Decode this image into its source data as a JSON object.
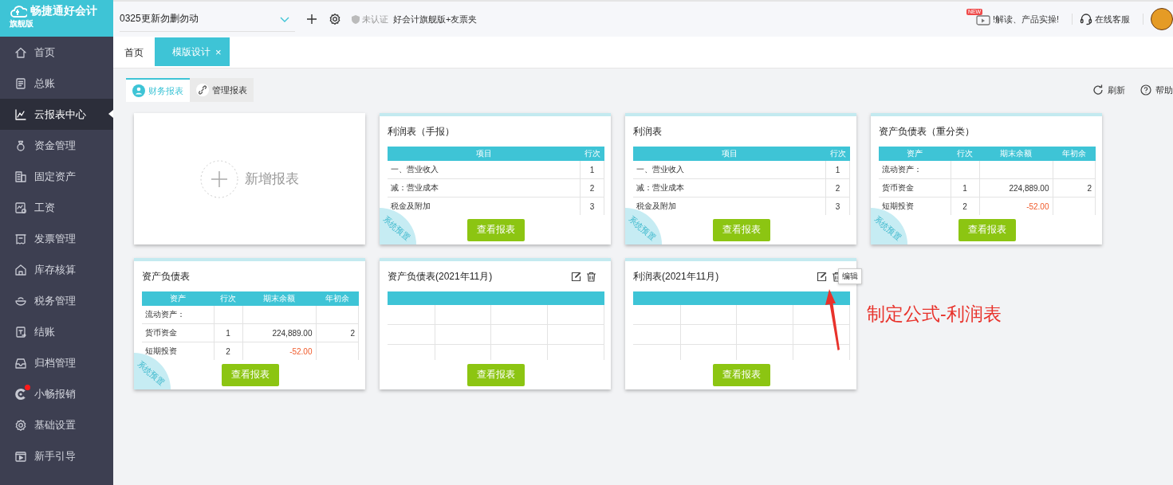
{
  "sidebar": {
    "logo": {
      "name": "畅捷通好会计",
      "edition": "旗舰版"
    },
    "items": [
      {
        "label": "首页",
        "selected": false,
        "notification": false
      },
      {
        "label": "总账",
        "selected": false,
        "notification": false
      },
      {
        "label": "云报表中心",
        "selected": true,
        "notification": false
      },
      {
        "label": "资金管理",
        "selected": false,
        "notification": false
      },
      {
        "label": "固定资产",
        "selected": false,
        "notification": false
      },
      {
        "label": "工资",
        "selected": false,
        "notification": false
      },
      {
        "label": "发票管理",
        "selected": false,
        "notification": false
      },
      {
        "label": "库存核算",
        "selected": false,
        "notification": false
      },
      {
        "label": "税务管理",
        "selected": false,
        "notification": false
      },
      {
        "label": "结账",
        "selected": false,
        "notification": false
      },
      {
        "label": "归档管理",
        "selected": false,
        "notification": false
      },
      {
        "label": "小畅报销",
        "selected": false,
        "notification": true
      },
      {
        "label": "基础设置",
        "selected": false,
        "notification": false
      },
      {
        "label": "新手引导",
        "selected": false,
        "notification": false
      }
    ]
  },
  "topbar": {
    "company": "0325更新勿删勿动",
    "certification": "未认证",
    "edition": "好会计旗舰版+友票夹",
    "promo_badge": "NEW",
    "promo": "!解读、产品实操!",
    "support": "在线客服"
  },
  "tabs": [
    {
      "label": "首页",
      "selected": false
    },
    {
      "label": "模版设计",
      "selected": true,
      "close": "×"
    }
  ],
  "subtabs": [
    {
      "label": "财务报表",
      "selected": true
    },
    {
      "label": "管理报表",
      "selected": false
    }
  ],
  "actions": [
    {
      "label": "刷新"
    },
    {
      "label": "帮助"
    }
  ],
  "cards": [
    {
      "kind": "new",
      "label": "新增报表"
    },
    {
      "kind": "report",
      "title": "利润表（手报）",
      "preset": true,
      "preset_label": "系统预置",
      "editable": false,
      "button": "查看报表",
      "preview": {
        "kind": "table",
        "columns": [
          "项目",
          "行次"
        ],
        "rows": [
          [
            "一、营业收入",
            "1"
          ],
          [
            "减：营业成本",
            "2"
          ],
          [
            "税金及附加",
            "3"
          ]
        ]
      }
    },
    {
      "kind": "report",
      "title": "利润表",
      "preset": true,
      "preset_label": "系统预置",
      "editable": false,
      "button": "查看报表",
      "preview": {
        "kind": "table",
        "columns": [
          "项目",
          "行次"
        ],
        "rows": [
          [
            "一、营业收入",
            "1"
          ],
          [
            "减：营业成本",
            "2"
          ],
          [
            "税金及附加",
            "3"
          ]
        ]
      }
    },
    {
      "kind": "report",
      "title": "资产负债表（重分类）",
      "preset": true,
      "preset_label": "系统预置",
      "editable": false,
      "button": "查看报表",
      "preview": {
        "kind": "table",
        "columns": [
          "资产",
          "行次",
          "期末余额",
          "年初余"
        ],
        "rows": [
          [
            "流动资产：",
            "",
            "",
            ""
          ],
          [
            "货币资金",
            "1",
            "224,889.00",
            "2"
          ],
          [
            "短期投资",
            "2",
            {
              "text": "-52.00",
              "negative": true
            },
            ""
          ]
        ]
      }
    },
    {
      "kind": "report",
      "title": "资产负债表",
      "preset": true,
      "preset_label": "系统预置",
      "editable": false,
      "button": "查看报表",
      "preview": {
        "kind": "table",
        "columns": [
          "资产",
          "行次",
          "期末余额",
          "年初余"
        ],
        "rows": [
          [
            "流动资产：",
            "",
            "",
            ""
          ],
          [
            "货币资金",
            "1",
            "224,889.00",
            "2"
          ],
          [
            "短期投资",
            "2",
            {
              "text": "-52.00",
              "negative": true
            },
            ""
          ]
        ]
      }
    },
    {
      "kind": "report",
      "title": "资产负债表(2021年11月)",
      "preset": false,
      "editable": true,
      "button": "查看报表",
      "preview": {
        "kind": "blank"
      }
    },
    {
      "kind": "report",
      "title": "利润表(2021年11月)",
      "preset": false,
      "editable": true,
      "tooltip": "编辑",
      "button": "查看报表",
      "preview": {
        "kind": "blank"
      }
    }
  ],
  "annotation": {
    "text": "制定公式-利润表"
  }
}
